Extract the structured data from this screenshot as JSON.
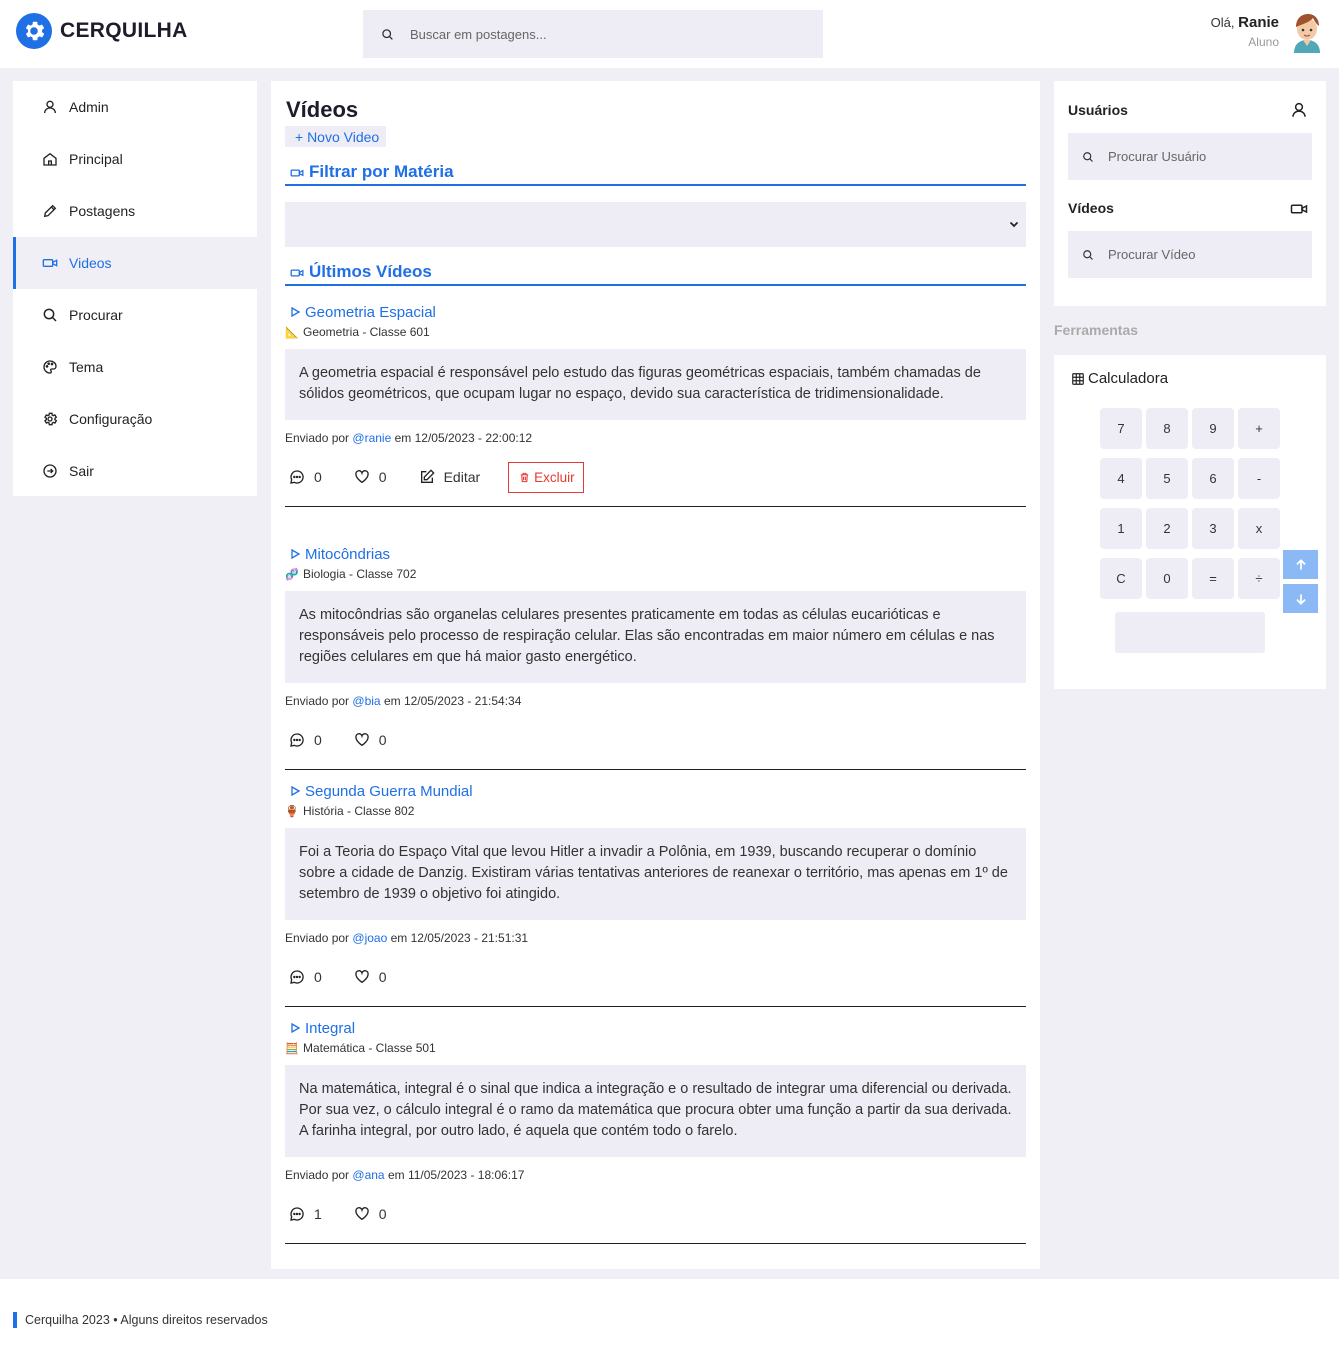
{
  "app": {
    "brand": "CERQUILHA",
    "accent": "#1f6fe5",
    "danger": "#e53935"
  },
  "header": {
    "search_placeholder": "Buscar em postagens...",
    "greeting": "Olá,",
    "user_name": "Ranie",
    "user_role": "Aluno"
  },
  "sidebar": {
    "items": [
      {
        "label": "Admin",
        "icon": "user-icon"
      },
      {
        "label": "Principal",
        "icon": "home-icon"
      },
      {
        "label": "Postagens",
        "icon": "pencil-icon"
      },
      {
        "label": "Videos",
        "icon": "video-icon",
        "active": true
      },
      {
        "label": "Procurar",
        "icon": "search-icon"
      },
      {
        "label": "Tema",
        "icon": "palette-icon"
      },
      {
        "label": "Configuração",
        "icon": "gear-icon"
      },
      {
        "label": "Sair",
        "icon": "logout-icon"
      }
    ]
  },
  "main": {
    "title": "Vídeos",
    "new_button": "+ Novo Video",
    "filter_heading": "Filtrar por Matéria",
    "filter_value": "",
    "latest_heading": "Últimos Vídeos",
    "posts": [
      {
        "title": "Geometria Espacial",
        "emoji": "📐",
        "meta": "Geometria - Classe 601",
        "body": "A geometria espacial é responsável pelo estudo das figuras geométricas espaciais, também chamadas de sólidos geométricos, que ocupam lugar no espaço, devido sua característica de tridimensionalidade.",
        "sent_prefix": "Enviado por",
        "author": "@ranie",
        "sent_suffix": "em 12/05/2023 - 22:00:12",
        "comments": "0",
        "likes": "0",
        "edit_label": "Editar",
        "delete_label": "Excluir"
      },
      {
        "title": "Mitocôndrias",
        "emoji": "🧬",
        "meta": "Biologia - Classe 702",
        "body": "As mitocôndrias são organelas celulares presentes praticamente em todas as células eucarióticas e responsáveis pelo processo de respiração celular. Elas são encontradas em maior número em células e nas regiões celulares em que há maior gasto energético.",
        "sent_prefix": "Enviado por",
        "author": "@bia",
        "sent_suffix": "em 12/05/2023 - 21:54:34",
        "comments": "0",
        "likes": "0"
      },
      {
        "title": "Segunda Guerra Mundial",
        "emoji": "🏺",
        "meta": "História - Classe 802",
        "body": "Foi a Teoria do Espaço Vital que levou Hitler a invadir a Polônia, em 1939, buscando recuperar o domínio sobre a cidade de Danzig. Existiram várias tentativas anteriores de reanexar o território, mas apenas em 1º de setembro de 1939 o objetivo foi atingido.",
        "sent_prefix": "Enviado por",
        "author": "@joao",
        "sent_suffix": "em 12/05/2023 - 21:51:31",
        "comments": "0",
        "likes": "0"
      },
      {
        "title": "Integral",
        "emoji": "🧮",
        "meta": "Matemática - Classe 501",
        "body": "Na matemática, integral é o sinal que indica a integração e o resultado de integrar uma diferencial ou derivada. Por sua vez, o cálculo integral é o ramo da matemática que procura obter uma função a partir da sua derivada. A farinha integral, por outro lado, é aquela que contém todo o farelo.",
        "sent_prefix": "Enviado por",
        "author": "@ana",
        "sent_suffix": "em 11/05/2023 - 18:06:17",
        "comments": "1",
        "likes": "0"
      }
    ]
  },
  "right": {
    "users_label": "Usuários",
    "users_search_placeholder": "Procurar Usuário",
    "videos_label": "Vídeos",
    "videos_search_placeholder": "Procurar Vídeo",
    "tools_label": "Ferramentas",
    "calculator_title": "Calculadora",
    "calculator_keys": [
      "7",
      "8",
      "9",
      "+",
      "4",
      "5",
      "6",
      "-",
      "1",
      "2",
      "3",
      "x",
      "C",
      "0",
      "=",
      "÷"
    ],
    "calculator_display": ""
  },
  "footer": {
    "text": "Cerquilha 2023 • Alguns direitos reservados"
  }
}
